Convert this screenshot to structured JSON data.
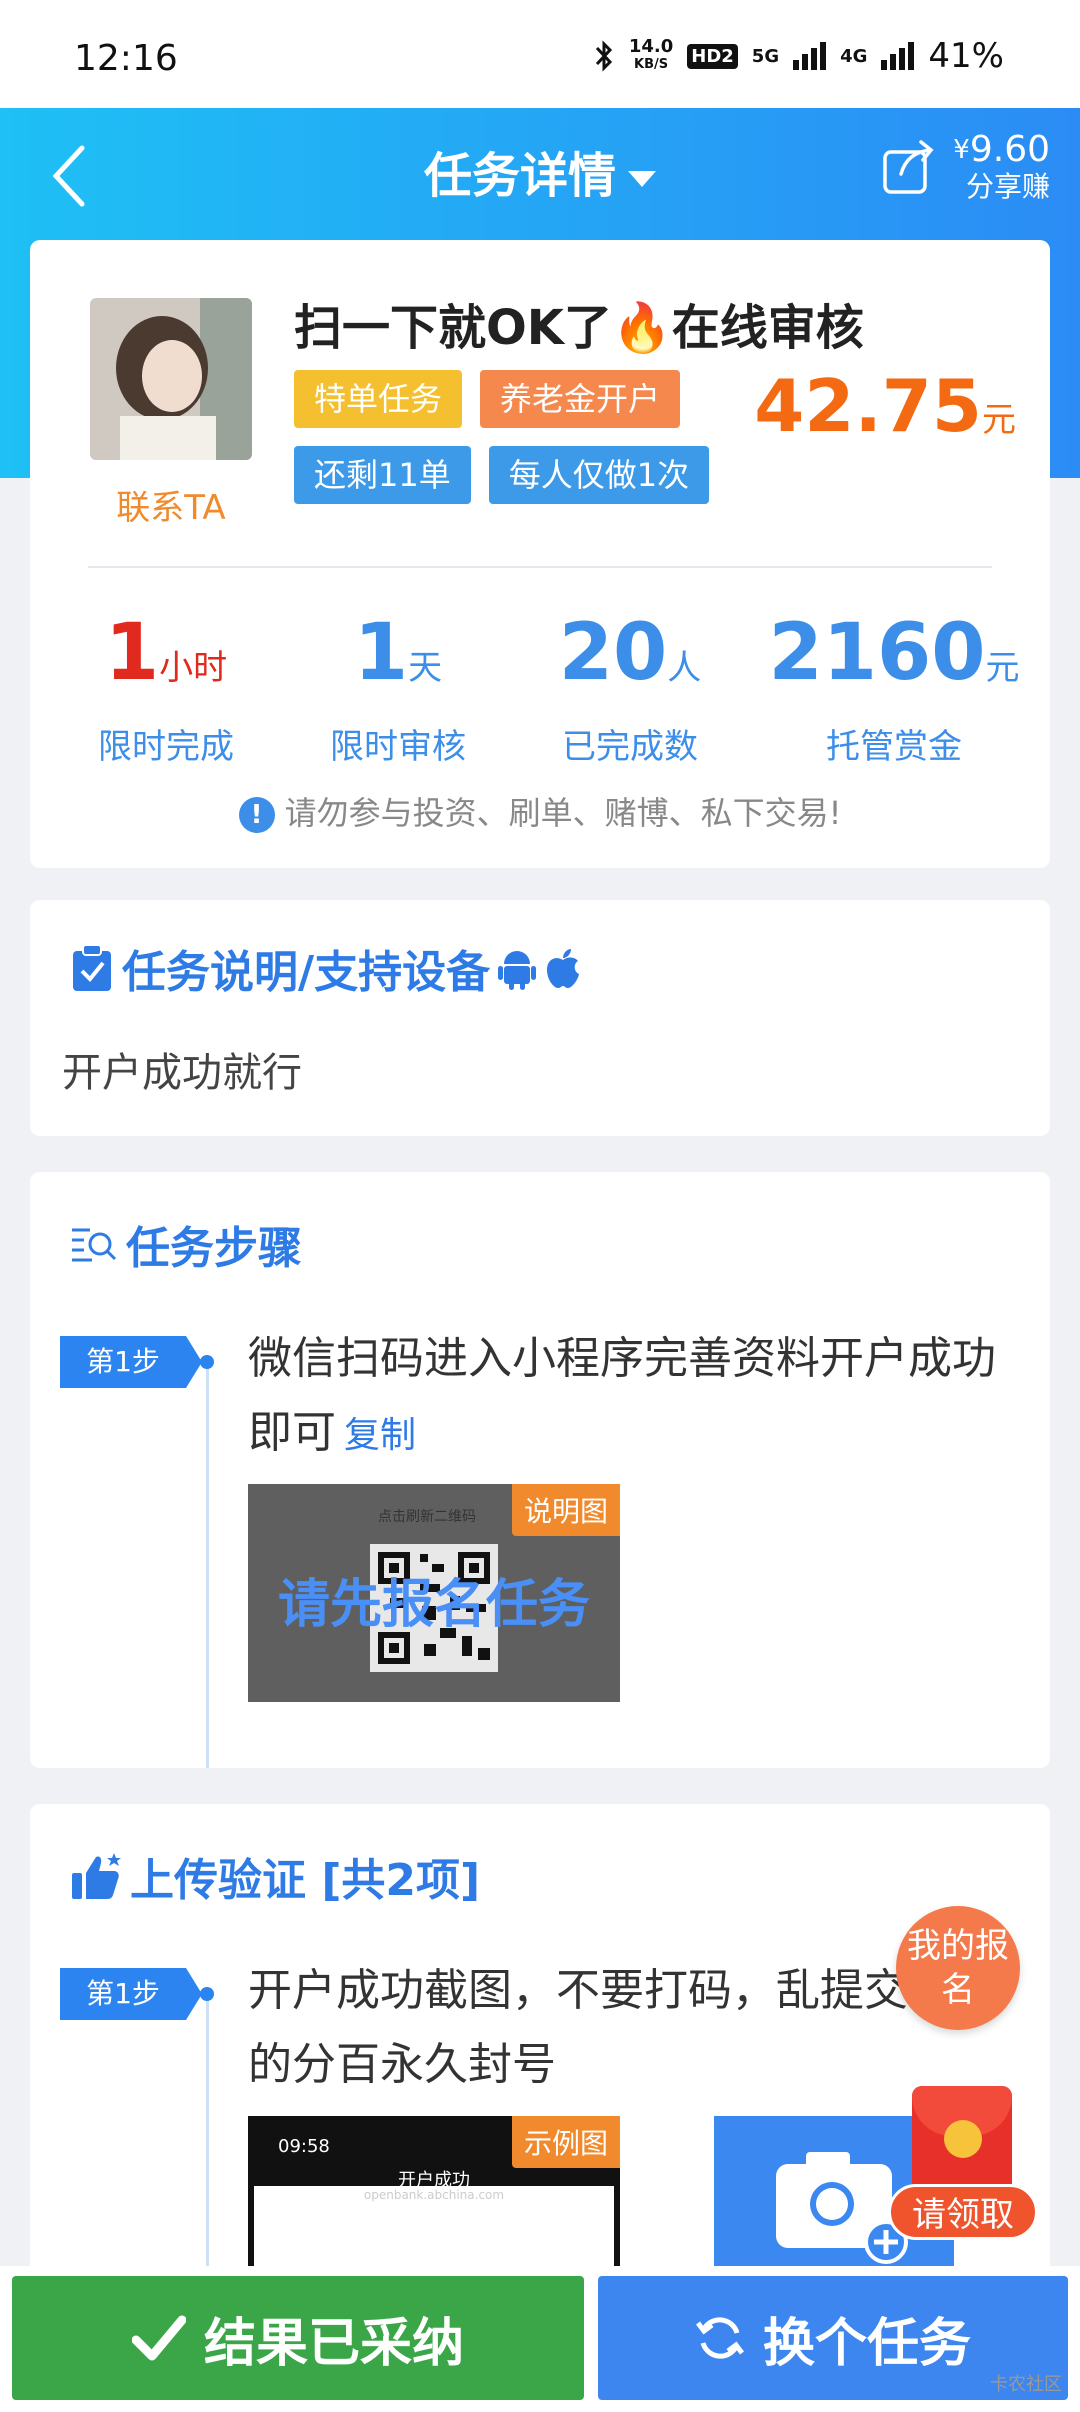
{
  "status_bar": {
    "time": "12:16",
    "net_speed_value": "14.0",
    "net_speed_unit": "KB/S",
    "hd_label": "HD2",
    "sig1": "5G",
    "sig2": "4G",
    "battery": "41%"
  },
  "header": {
    "title": "任务详情",
    "share_currency": "¥",
    "share_amount": "9.60",
    "share_label": "分享赚"
  },
  "task": {
    "contact_label": "联系TA",
    "title": "扫一下就OK了🔥在线审核",
    "tags": [
      {
        "label": "特单任务",
        "color": "#f5c02f"
      },
      {
        "label": "养老金开户",
        "color": "#f5884d"
      },
      {
        "label": "还剩11单",
        "color": "#3c9ae8"
      },
      {
        "label": "每人仅做1次",
        "color": "#3c9ae8"
      }
    ],
    "price": "42.75",
    "price_unit": "元",
    "stats": [
      {
        "num": "1",
        "unit": "小时",
        "label": "限时完成",
        "color": "#e02a20"
      },
      {
        "num": "1",
        "unit": "天",
        "label": "限时审核",
        "color": "#3c8ee8"
      },
      {
        "num": "20",
        "unit": "人",
        "label": "已完成数",
        "color": "#3c8ee8"
      },
      {
        "num": "2160",
        "unit": "元",
        "label": "托管赏金",
        "color": "#3c8ee8"
      }
    ],
    "warning": "请勿参与投资、刷单、赌博、私下交易!"
  },
  "description": {
    "title": "任务说明/支持设备",
    "text": "开户成功就行"
  },
  "steps": {
    "title": "任务步骤",
    "step_label": "第1步",
    "text": "微信扫码进入小程序完善资料开户成功即可",
    "copy_label": "复制",
    "image_badge": "说明图",
    "image_overlay": "请先报名任务",
    "image_small_text": "点击刷新二维码"
  },
  "upload": {
    "title": "上传验证 [共2项]",
    "step_label": "第1步",
    "text": "开户成功截图，不要打码，乱提交的分百永久封号",
    "example_badge": "示例图",
    "example_time": "09:58",
    "example_title": "开户成功",
    "example_url": "openbank.abchina.com"
  },
  "floating": {
    "my_signup": "我的报名",
    "redpack_label": "请领取"
  },
  "bottom": {
    "accept_label": "结果已采纳",
    "switch_label": "换个任务",
    "watermark": "卡农社区"
  }
}
